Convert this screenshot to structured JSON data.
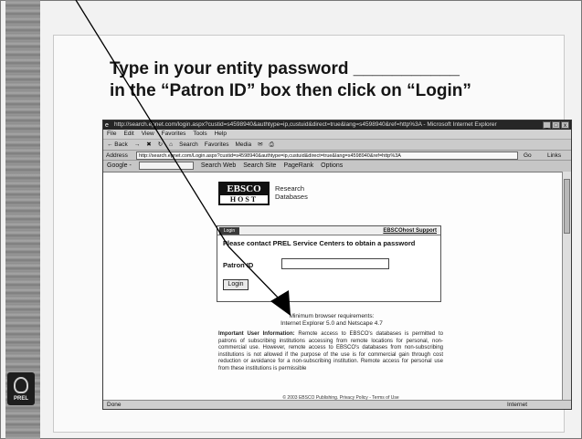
{
  "slide": {
    "title_line1": "Type in your entity password ___________",
    "title_line2": "in the “Patron ID” box then click on “Login”",
    "brand": "PREL"
  },
  "browser": {
    "window_title": "http://search.epnet.com/login.aspx?custid=s4598940&authtype=ip,custuid&direct=true&lang=s4598940&ref=http%3A - Microsoft Internet Explorer",
    "menu": [
      "File",
      "Edit",
      "View",
      "Favorites",
      "Tools",
      "Help"
    ],
    "toolbar": [
      "← Back",
      "→",
      "✖",
      "↻",
      "⌂",
      "Search",
      "Favorites",
      "Media",
      "✉",
      "⎙"
    ],
    "address_label": "Address",
    "address_url": "http://search.epnet.com/Login.aspx?custid=s4598940&authtype=ip,custuid&direct=true&lang=s4598940&ref=http%3A",
    "go_label": "Go",
    "links_label": "Links",
    "google_label": "Google -",
    "google_buttons": [
      "Search Web",
      "Search Site",
      "PageRank",
      "Options"
    ],
    "status_left": "Done",
    "status_zone": "Internet"
  },
  "page": {
    "logo_top": "EBSCO",
    "logo_bottom": "HOST",
    "logo_tagline": "Research Databases",
    "panel_tab": "Login",
    "support_link": "EBSCOhost Support",
    "panel_message": "Please contact PREL Service Centers to obtain a password",
    "patron_label": "Patron ID",
    "patron_value": "",
    "login_button": "Login",
    "requirements_line1": "Minimum browser requirements:",
    "requirements_line2": "Internet Explorer 5.0 and Netscape 4.7",
    "notice_heading": "Important User Information:",
    "notice_text": " Remote access to EBSCO's databases is permitted to patrons of subscribing institutions accessing from remote locations for personal, non-commercial use. However, remote access to EBSCO's databases from non-subscribing institutions is not allowed if the purpose of the use is for commercial gain through cost reduction or avoidance for a non-subscribing institution. Remote access for personal use from these institutions is permissible",
    "copyright": "© 2003 EBSCO Publishing. Privacy Policy - Terms of Use"
  },
  "colors": {
    "slide_bg": "#f2f2f2",
    "browser_chrome": "#c4c4c4",
    "titlebar": "#262626",
    "arrow": "#000000"
  }
}
